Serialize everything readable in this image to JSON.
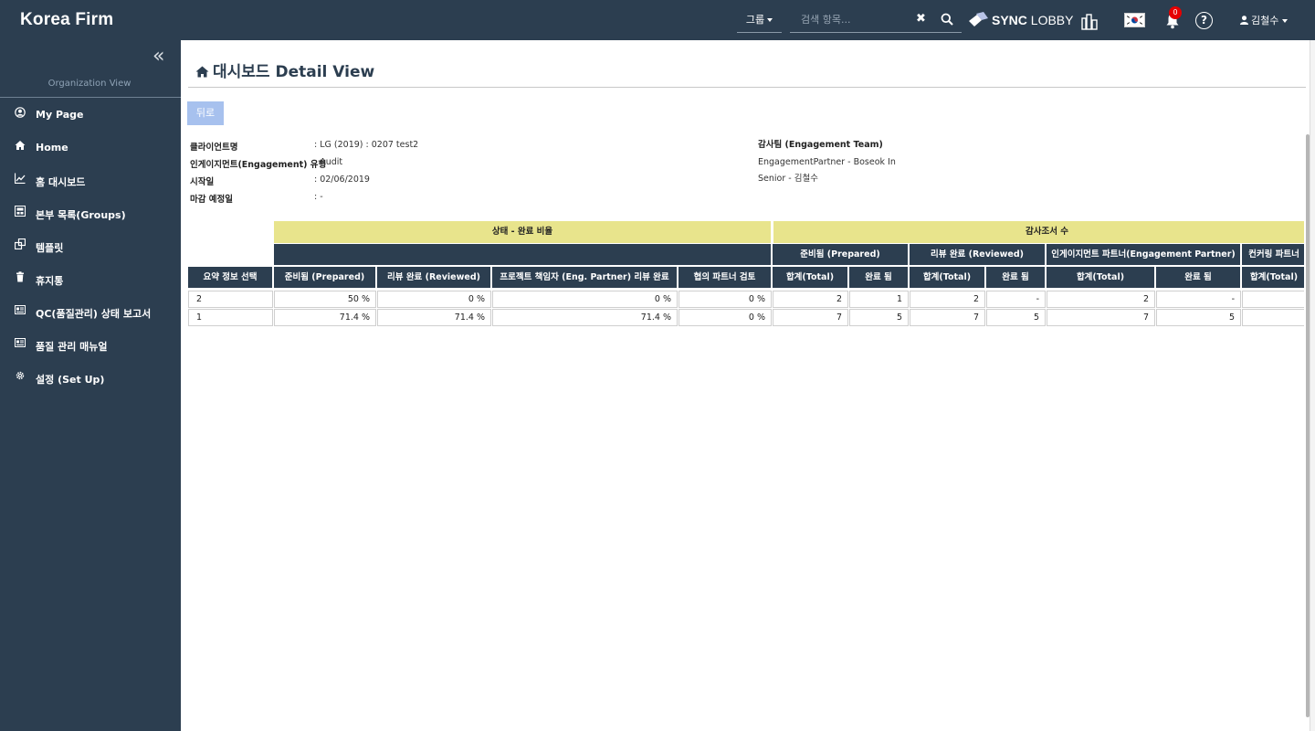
{
  "app": {
    "brand": "Korea Firm"
  },
  "header": {
    "group_label": "그룹",
    "search_placeholder": "검색 항목...",
    "clear_symbol": "✖",
    "sync_brand_bold": "SYNC",
    "sync_brand_rest": " LOBBY",
    "notification_count": "0",
    "help_symbol": "?",
    "user_name": "김철수"
  },
  "sidebar": {
    "collapse_symbol": "«",
    "org_view": "Organization View",
    "items": [
      {
        "label": "My Page",
        "icon": "user-circle-icon"
      },
      {
        "label": "Home",
        "icon": "home-icon"
      },
      {
        "label": "홈 대시보드",
        "icon": "line-chart-icon"
      },
      {
        "label": "본부 목록(Groups)",
        "icon": "org-chart-icon"
      },
      {
        "label": "템플릿",
        "icon": "clone-icon"
      },
      {
        "label": "휴지통",
        "icon": "trash-icon"
      },
      {
        "label": "QC(품질관리) 상태 보고서",
        "icon": "report-icon"
      },
      {
        "label": "품질 관리 매뉴얼",
        "icon": "manual-icon"
      },
      {
        "label": "설정 (Set Up)",
        "icon": "gear-icon"
      }
    ]
  },
  "main": {
    "title": "대시보드 Detail View",
    "back_label": "뒤로",
    "info": [
      {
        "label": "클라이언트명",
        "value": ": LG (2019) : 0207 test2"
      },
      {
        "label": "인게이지먼트(Engagement) 유형",
        "value": ": Audit"
      },
      {
        "label": "시작일",
        "value": ": 02/06/2019"
      },
      {
        "label": "마감 예정일",
        "value": ": -"
      }
    ],
    "team": {
      "title": "감사팀 (Engagement Team)",
      "members": [
        "EngagementPartner - Boseok In",
        "Senior - 김철수"
      ]
    }
  },
  "table": {
    "group_headers": {
      "status": "상태 - 완료 비율",
      "count": "감사조서 수"
    },
    "sub_headers": [
      "준비됨 (Prepared)",
      "리뷰 완료 (Reviewed)",
      "인게이지먼트 파트너(Engagement Partner)",
      "컨커링 파트너"
    ],
    "columns": [
      "요약 정보 선택",
      "준비됨 (Prepared)",
      "리뷰 완료 (Reviewed)",
      "프로젝트 책임자 (Eng. Partner) 리뷰 완료",
      "협의 파트너 검토",
      "합계(Total)",
      "완료 됨",
      "합계(Total)",
      "완료 됨",
      "합계(Total)",
      "완료 됨",
      "합계(Total)"
    ],
    "rows": [
      [
        "2",
        "50 %",
        "0 %",
        "0 %",
        "0 %",
        "2",
        "1",
        "2",
        "-",
        "2",
        "-",
        ""
      ],
      [
        "1",
        "71.4 %",
        "71.4 %",
        "71.4 %",
        "0 %",
        "7",
        "5",
        "7",
        "5",
        "7",
        "5",
        ""
      ]
    ]
  }
}
